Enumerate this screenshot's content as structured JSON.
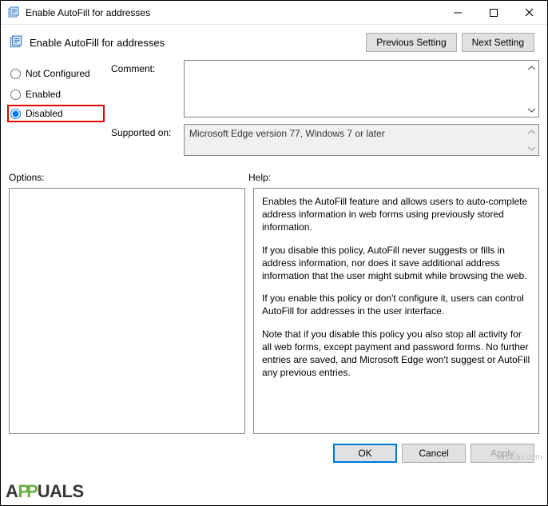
{
  "titlebar": {
    "title": "Enable AutoFill for addresses"
  },
  "header": {
    "title": "Enable AutoFill for addresses",
    "previous_button": "Previous Setting",
    "next_button": "Next Setting"
  },
  "radios": {
    "not_configured": "Not Configured",
    "enabled": "Enabled",
    "disabled": "Disabled"
  },
  "fields": {
    "comment_label": "Comment:",
    "comment_value": "",
    "supported_label": "Supported on:",
    "supported_value": "Microsoft Edge version 77, Windows 7 or later"
  },
  "lower": {
    "options_label": "Options:",
    "help_label": "Help:"
  },
  "help": {
    "p1": "Enables the AutoFill feature and allows users to auto-complete address information in web forms using previously stored information.",
    "p2": "If you disable this policy, AutoFill never suggests or fills in address information, nor does it save additional address information that the user might submit while browsing the web.",
    "p3": "If you enable this policy or don't configure it, users can control AutoFill for addresses in the user interface.",
    "p4": "Note that if you disable this policy you also stop all activity for all web forms, except payment and password forms. No further entries are saved, and Microsoft Edge won't suggest or AutoFill any previous entries."
  },
  "footer": {
    "ok": "OK",
    "cancel": "Cancel",
    "apply": "Apply"
  },
  "watermark": "wsxdn.com",
  "logo": {
    "left": "A",
    "mid": "PP",
    "right": "UALS"
  }
}
